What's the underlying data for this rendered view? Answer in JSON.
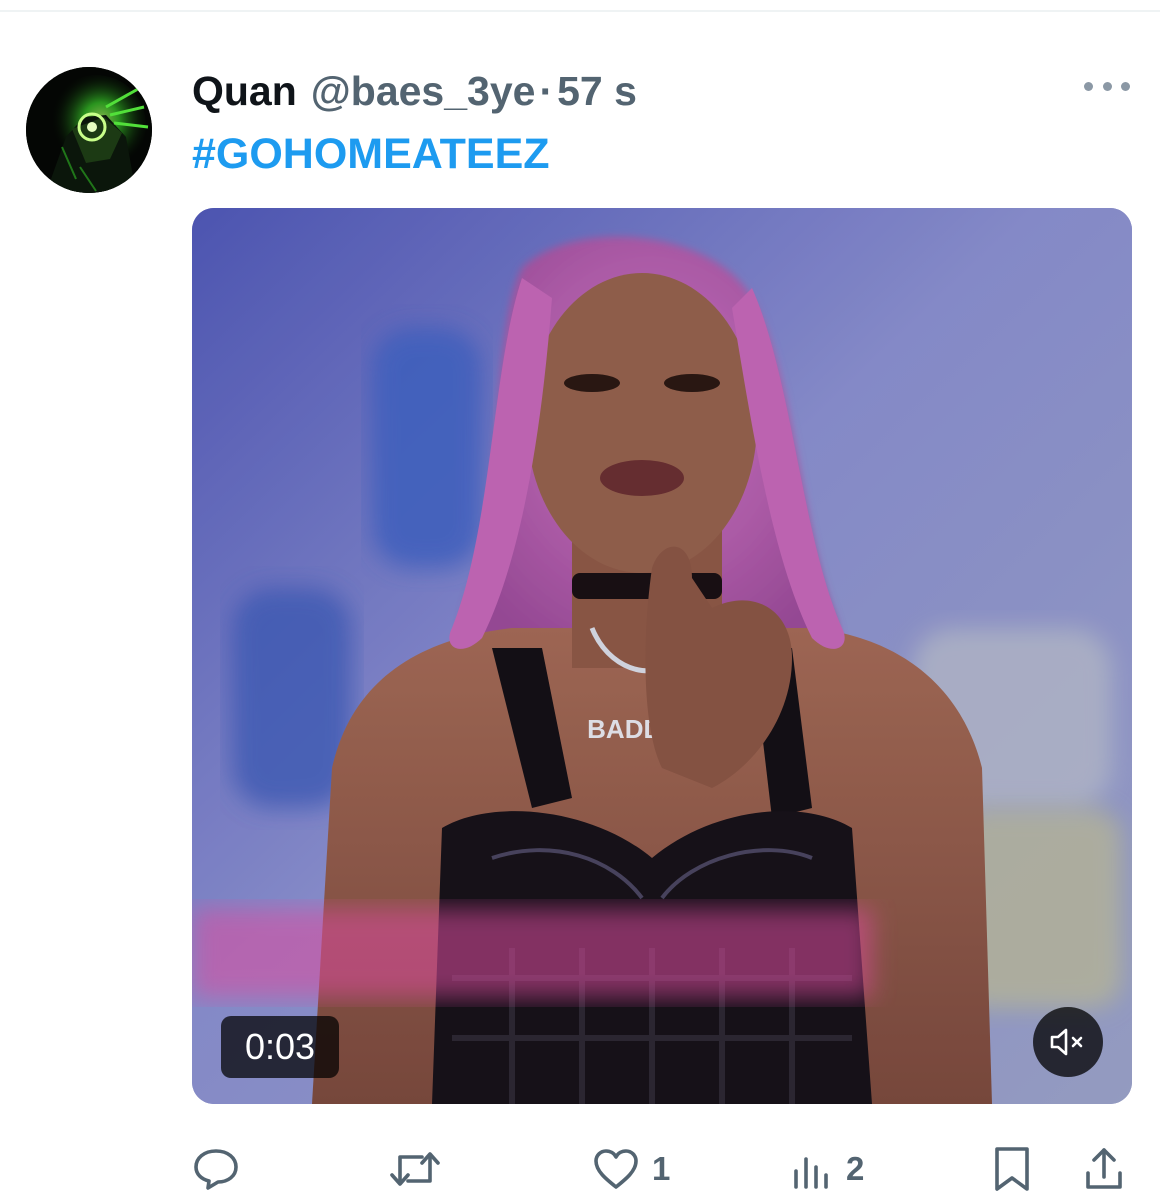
{
  "tweet": {
    "display_name": "Quan",
    "handle": "@baes_3ye",
    "separator": "·",
    "timestamp": "57 s",
    "hashtag": "#GOHOMEATEEZ",
    "avatar_icon": "anime-green-glow-avatar",
    "more_icon": "more-horizontal-icon"
  },
  "media": {
    "type": "video",
    "duration": "0:03",
    "caption_on_screen": "BADDIE",
    "mute_icon": "speaker-muted-icon"
  },
  "actions": {
    "reply": {
      "icon": "reply-bubble-icon",
      "count": ""
    },
    "retweet": {
      "icon": "retweet-icon",
      "count": ""
    },
    "like": {
      "icon": "heart-icon",
      "count": "1"
    },
    "views": {
      "icon": "analytics-bars-icon",
      "count": "2"
    },
    "bookmark": {
      "icon": "bookmark-icon",
      "count": ""
    },
    "share": {
      "icon": "share-upload-icon",
      "count": ""
    }
  },
  "colors": {
    "accent": "#1d9bf0",
    "text_primary": "#0f1419",
    "text_secondary": "#536471",
    "icon": "#536471"
  }
}
